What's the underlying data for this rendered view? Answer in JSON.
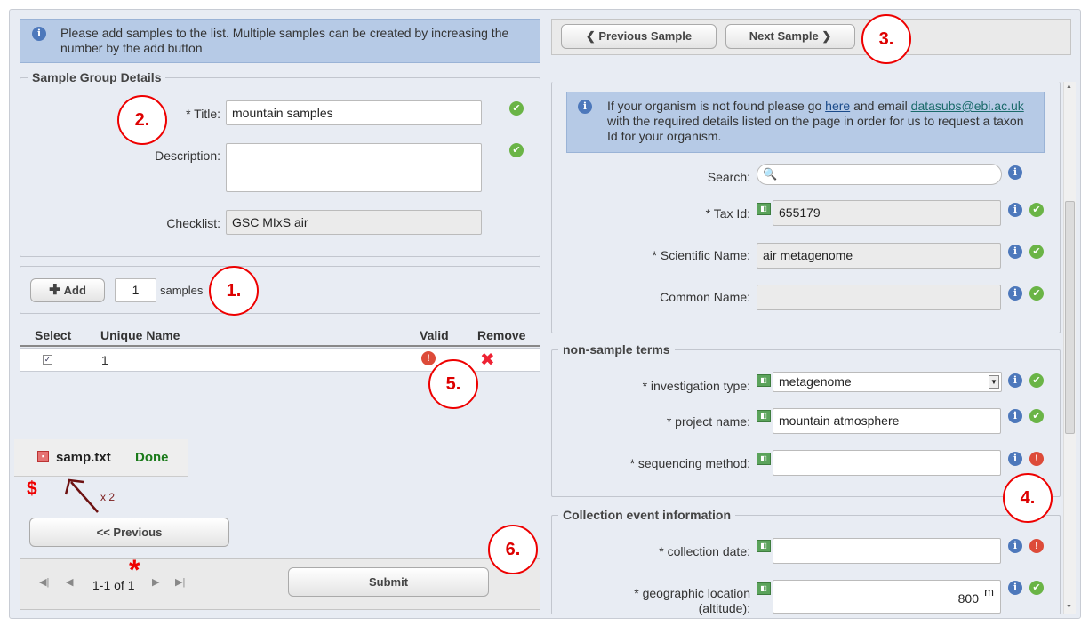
{
  "info_msg": "Please add samples to the list. Multiple samples can be created by increasing the number by the add button",
  "group_legend": "Sample Group Details",
  "title_label": "* Title:",
  "title_value": "mountain samples",
  "desc_label": "Description:",
  "checklist_label": "Checklist:",
  "checklist_value": "GSC MIxS air",
  "add_label": "Add",
  "add_count": "1",
  "samples_label": "samples",
  "table": {
    "headers": [
      "Select",
      "Unique Name",
      "Valid",
      "Remove"
    ],
    "row": {
      "name": "1"
    }
  },
  "file": {
    "name": "samp.txt",
    "status": "Done"
  },
  "annot": {
    "dollar": "$",
    "x2": "x 2",
    "star": "*"
  },
  "prev_label": "<< Previous",
  "pager": "1-1 of 1",
  "submit_label": "Submit",
  "nav": {
    "prev": "Previous Sample",
    "next": "Next Sample"
  },
  "organism_info": {
    "pre": "If your organism is not found please go ",
    "link": "here",
    "mid": " and email ",
    "email": "datasubs@ebi.ac.uk",
    "post": " with the required details listed on the page in order for us to request a taxon Id for your organism."
  },
  "search_label": "Search:",
  "taxid_label": "* Tax Id:",
  "taxid_value": "655179",
  "sci_label": "* Scientific Name:",
  "sci_value": "air metagenome",
  "common_label": "Common Name:",
  "nst_legend": "non-sample terms",
  "inv_label": "* investigation type:",
  "inv_value": "metagenome",
  "proj_label": "* project name:",
  "proj_value": "mountain atmosphere",
  "seq_label": "* sequencing method:",
  "ce_legend": "Collection event information",
  "date_label": "* collection date:",
  "geo_label1": "* geographic location",
  "geo_label2": "(altitude):",
  "geo_value": "800",
  "geo_unit": "m",
  "circles": [
    "1.",
    "2.",
    "3.",
    "4.",
    "5.",
    "6."
  ],
  "colors": {
    "panel": "#e8ecf3",
    "info": "#b6cae6",
    "annot": "#e00000",
    "done": "#1a7a1a"
  }
}
